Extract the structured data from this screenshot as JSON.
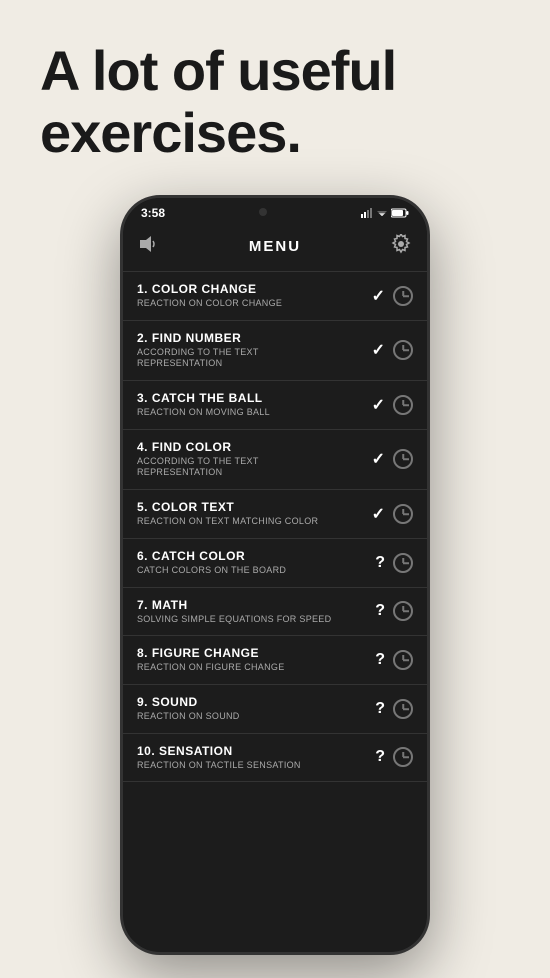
{
  "page": {
    "title_line1": "A lot of useful",
    "title_line2": "exercises.",
    "background_color": "#f0ece4"
  },
  "phone": {
    "status_bar": {
      "time": "3:58"
    },
    "nav": {
      "title": "MENU"
    },
    "exercises": [
      {
        "number": "1",
        "title": "1. COLOR CHANGE",
        "subtitle": "REACTION ON COLOR CHANGE",
        "completed": true,
        "has_history": true
      },
      {
        "number": "2",
        "title": "2. FIND NUMBER",
        "subtitle": "ACCORDING TO THE TEXT\nREPRESENTATION",
        "completed": true,
        "has_history": true
      },
      {
        "number": "3",
        "title": "3. CATCH THE BALL",
        "subtitle": "REACTION ON MOVING BALL",
        "completed": true,
        "has_history": true
      },
      {
        "number": "4",
        "title": "4. FIND COLOR",
        "subtitle": "ACCORDING TO THE TEXT\nREPRESENTATION",
        "completed": true,
        "has_history": true
      },
      {
        "number": "5",
        "title": "5. COLOR TEXT",
        "subtitle": "REACTION ON TEXT MATCHING COLOR",
        "completed": true,
        "has_history": true
      },
      {
        "number": "6",
        "title": "6. CATCH COLOR",
        "subtitle": "CATCH COLORS ON THE BOARD",
        "completed": false,
        "has_history": true
      },
      {
        "number": "7",
        "title": "7. MATH",
        "subtitle": "SOLVING SIMPLE EQUATIONS FOR SPEED",
        "completed": false,
        "has_history": true
      },
      {
        "number": "8",
        "title": "8. FIGURE CHANGE",
        "subtitle": "REACTION ON FIGURE CHANGE",
        "completed": false,
        "has_history": true
      },
      {
        "number": "9",
        "title": "9. SOUND",
        "subtitle": "REACTION ON SOUND",
        "completed": false,
        "has_history": true
      },
      {
        "number": "10",
        "title": "10. SENSATION",
        "subtitle": "REACTION ON TACTILE SENSATION",
        "completed": false,
        "has_history": true
      }
    ]
  }
}
